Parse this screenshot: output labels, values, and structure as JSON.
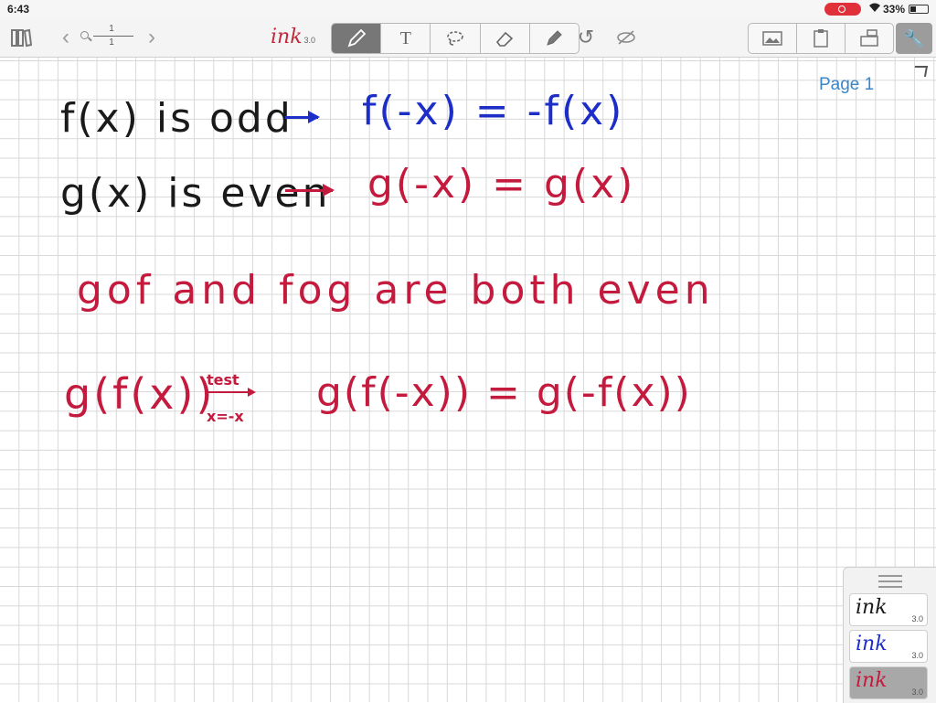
{
  "status_bar": {
    "time": "6:43",
    "battery": "33%",
    "battery_level": 0.33
  },
  "toolbar": {
    "page_current": "1",
    "page_total": "1",
    "logo_word": "ink",
    "logo_version": "3.0",
    "tools": [
      {
        "name": "pen-tool",
        "icon": "pen-icon",
        "active": true
      },
      {
        "name": "text-tool",
        "icon": "text-icon",
        "glyph": "T",
        "active": false
      },
      {
        "name": "lasso-tool",
        "icon": "lasso-icon",
        "active": false
      },
      {
        "name": "eraser-tool",
        "icon": "eraser-icon",
        "active": false
      },
      {
        "name": "highlighter-tool",
        "icon": "highlighter-icon",
        "active": false
      }
    ],
    "right_tools": [
      "image-icon",
      "clipboard-icon",
      "insert-icon"
    ],
    "settings_icon": "wrench-icon"
  },
  "canvas": {
    "page_label": "Page 1",
    "colors": {
      "black": "#1a1a1a",
      "blue": "#1d2ec8",
      "red": "#c41a3e"
    },
    "lines": {
      "l1_left": "f(x) is odd",
      "l1_right": "f(-x) = -f(x)",
      "l2_left": "g(x) is even",
      "l2_right": "g(-x) = g(x)",
      "l3": "gof and fog are both even",
      "l4_left": "g(f(x))",
      "l4_ann_top": "test",
      "l4_ann_bottom": "x=-x",
      "l4_right": "g(f(-x)) = g(-f(x))"
    }
  },
  "pen_panel": {
    "pens": [
      {
        "word": "ink",
        "version": "3.0",
        "color": "#1a1a1a"
      },
      {
        "word": "ink",
        "version": "3.0",
        "color": "#1d2ec8"
      },
      {
        "word": "ink",
        "version": "3.0",
        "color": "#c41a3e",
        "selected": true
      }
    ]
  }
}
